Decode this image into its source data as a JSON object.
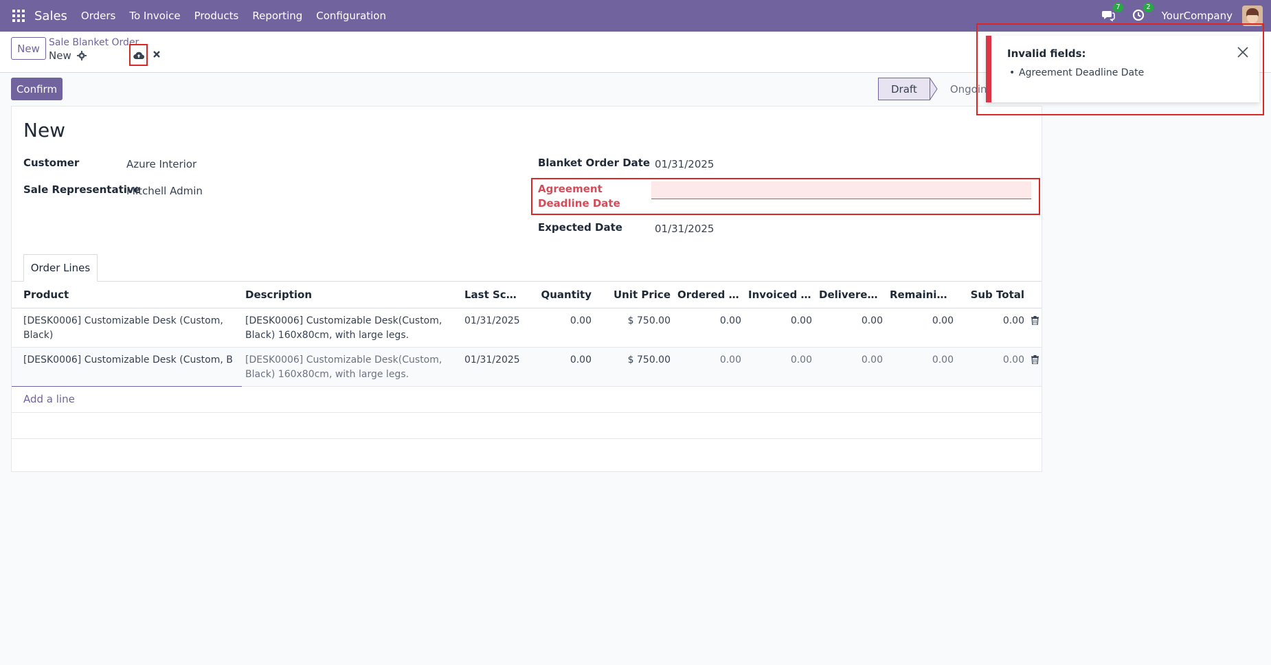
{
  "navbar": {
    "app_name": "Sales",
    "menu": [
      "Orders",
      "To Invoice",
      "Products",
      "Reporting",
      "Configuration"
    ],
    "messages_count": "7",
    "activities_count": "2",
    "company": "YourCompany"
  },
  "control": {
    "new_label": "New",
    "breadcrumb_parent": "Sale Blanket Order",
    "breadcrumb_current": "New"
  },
  "actions": {
    "confirm_label": "Confirm",
    "stages": [
      "Draft",
      "Ongoing"
    ]
  },
  "form": {
    "record_name": "New",
    "customer_label": "Customer",
    "customer_value": "Azure Interior",
    "salesrep_label": "Sale Representative",
    "salesrep_value": "Mitchell Admin",
    "order_date_label": "Blanket Order Date",
    "order_date_value": "01/31/2025",
    "deadline_label": "Agreement Deadline Date",
    "deadline_value": "",
    "expected_label": "Expected Date",
    "expected_value": "01/31/2025"
  },
  "tab": {
    "label": "Order Lines"
  },
  "lines": {
    "headers": [
      "Product",
      "Description",
      "Last Sche...",
      "Quantity",
      "Unit Price",
      "Ordered Qu...",
      "Invoiced Qu...",
      "Delivered Q...",
      "Remaining ...",
      "Sub Total"
    ],
    "rows": [
      {
        "product": "[DESK0006] Customizable Desk (Custom, Black)",
        "description": "[DESK0006] Customizable Desk(Custom, Black) 160x80cm, with large legs.",
        "last_scheduled": "01/31/2025",
        "quantity": "0.00",
        "unit_price": "$ 750.00",
        "ordered": "0.00",
        "invoiced": "0.00",
        "delivered": "0.00",
        "remaining": "0.00",
        "subtotal": "0.00"
      },
      {
        "product": "[DESK0006] Customizable Desk (Custom, B",
        "description": "[DESK0006] Customizable Desk(Custom, Black) 160x80cm, with large legs.",
        "last_scheduled": "01/31/2025",
        "quantity": "0.00",
        "unit_price": "$ 750.00",
        "ordered": "0.00",
        "invoiced": "0.00",
        "delivered": "0.00",
        "remaining": "0.00",
        "subtotal": "0.00"
      }
    ],
    "add_line_label": "Add a line"
  },
  "notification": {
    "title": "Invalid fields:",
    "items": [
      "Agreement Deadline Date"
    ]
  },
  "colors": {
    "brand": "#71639e",
    "danger": "#dc3545",
    "highlight": "#dc2626"
  }
}
